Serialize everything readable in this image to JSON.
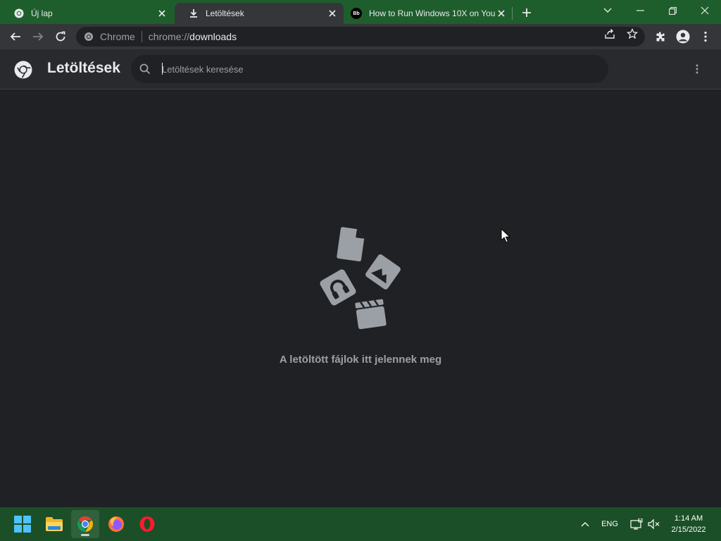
{
  "browser": {
    "tabs": [
      {
        "label": "Új lap",
        "icon": "chrome-icon",
        "active": false
      },
      {
        "label": "Letöltések",
        "icon": "download-icon",
        "active": true
      },
      {
        "label": "How to Run Windows 10X on You",
        "icon": "bb-favicon-icon",
        "active": false
      }
    ],
    "favicon_text": "Bb",
    "omnibox": {
      "scheme_label": "Chrome",
      "url_prefix": "chrome://",
      "url_path": "downloads"
    }
  },
  "page": {
    "title": "Letöltések",
    "search_placeholder": "Letöltések keresése",
    "empty_message": "A letöltött fájlok itt jelennek meg"
  },
  "taskbar": {
    "apps": [
      "start-icon",
      "file-explorer-icon",
      "chrome-icon",
      "firefox-icon",
      "opera-icon"
    ],
    "language": "ENG",
    "time": "1:14 AM",
    "date": "2/15/2022"
  },
  "colors": {
    "titlebar": "#1e5e2c",
    "toolbar": "#35363a",
    "page_bg": "#202124",
    "header_bg": "#292a2d",
    "taskbar": "#1a4f27"
  }
}
